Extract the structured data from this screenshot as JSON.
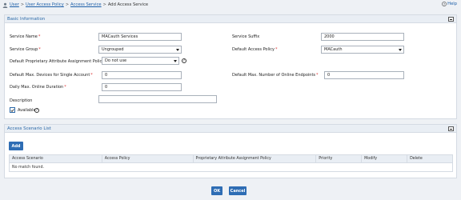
{
  "breadcrumb": {
    "items": [
      "User",
      "User Access Policy",
      "Access Service",
      "Add Access Service"
    ],
    "separator": ">"
  },
  "help": {
    "label": "Help"
  },
  "basic_info": {
    "title": "Basic Information",
    "service_name": {
      "label": "Service Name",
      "required": "*",
      "value": "MACauth Services"
    },
    "service_suffix": {
      "label": "Service Suffix",
      "value": "2000"
    },
    "service_group": {
      "label": "Service Group",
      "required": "*",
      "value": "Ungrouped"
    },
    "default_access_policy": {
      "label": "Default Access Policy",
      "required": "*",
      "value": "MACauth"
    },
    "default_proprietary": {
      "label": "Default Proprietary Attribute Assignment Policy",
      "required": "*",
      "value": "Do not use"
    },
    "max_devices": {
      "label": "Default Max. Devices for Single Account",
      "required": "*",
      "value": "0"
    },
    "max_endpoints": {
      "label": "Default Max. Number of Online Endpoints",
      "required": "*",
      "value": "0"
    },
    "daily_max": {
      "label": "Daily Max. Online Duration",
      "required": "*",
      "value": "0"
    },
    "description": {
      "label": "Description",
      "value": ""
    },
    "available": {
      "label": "Available",
      "checked": true
    }
  },
  "scenario_list": {
    "title": "Access Scenario List",
    "add_label": "Add",
    "columns": [
      "Access Scenario",
      "Access Policy",
      "Proprietary Attribute Assignment Policy",
      "Priority",
      "Modify",
      "Delete"
    ],
    "empty_message": "No match found."
  },
  "footer": {
    "ok_label": "OK",
    "cancel_label": "Cancel"
  },
  "colors": {
    "accent": "#2e6db4",
    "title": "#2b69a8",
    "panel_header": "#e9eef4",
    "background": "#eef1f5"
  },
  "icons": [
    "user-icon",
    "help-icon",
    "question-icon",
    "collapse-icon",
    "checkmark-icon"
  ]
}
